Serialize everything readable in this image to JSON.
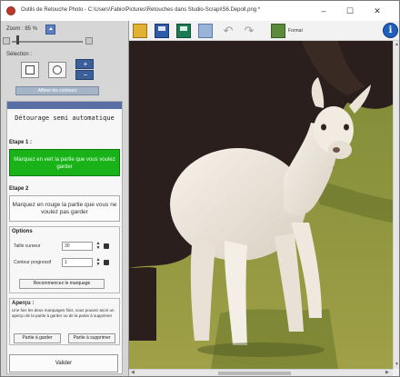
{
  "window": {
    "title": "Outils de Retouche Photo - C:\\Users\\Fabio\\Pictures\\Retouches dans Studio-Scrapi\\S6.Depoll.png *",
    "minimize": "–",
    "maximize": "☐",
    "close": "✕"
  },
  "sidebar": {
    "zoom_label": "Zoom : 85 %",
    "select_label": "Sélection :",
    "refine_button": "Affiner les contours"
  },
  "panel": {
    "title": "Détourage semi automatique",
    "step1_label": "Etape 1 :",
    "step1_button": "Marquez en vert la partie que vous voulez garder",
    "step2_label": "Etape 2",
    "step2_button": "Marquez en rouge la partie que vous ne voulez pas garder",
    "options": {
      "title": "Options",
      "cursor_size_label": "Taille curseur",
      "cursor_size_value": "30",
      "progressive_label": "Contour progressif",
      "progressive_value": "1",
      "restart_button": "Recommencez le marquage"
    },
    "preview": {
      "title": "Aperçu :",
      "text": "Une fois les deux marquages finis, vous pouvez avoir un aperçu de la partie à garder ou de la partie à supprimer",
      "keep_button": "Partie à garder",
      "delete_button": "Partie à supprimer"
    },
    "validate_button": "Valider"
  },
  "toolbar": {
    "format_label": "Format",
    "info_label": "i"
  },
  "colors": {
    "accent": "#5a6ea6",
    "green_step": "#19b319",
    "info_blue": "#1f5fbf"
  }
}
